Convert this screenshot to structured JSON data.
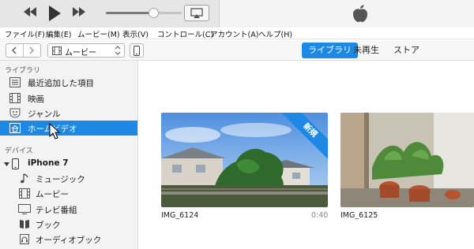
{
  "player": {
    "prev_icon": "rewind-icon",
    "play_icon": "play-icon",
    "next_icon": "fast-forward-icon",
    "volume_level": 0.62,
    "airplay_icon": "airplay-icon",
    "logo_icon": "apple-logo-icon"
  },
  "menubar": {
    "file": "ファイル(F)",
    "edit": "編集(E)",
    "movie": "ムービー(M)",
    "view": "表示(V)",
    "controls": "コントロール(C)",
    "account": "アカウント(A)",
    "help": "ヘルプ(H)"
  },
  "navbar": {
    "media_label": "ムービー",
    "tabs": {
      "library": "ライブラリ",
      "unwatched": "未再生",
      "store": "ストア"
    },
    "active_tab": "library"
  },
  "sidebar": {
    "library_header": "ライブラリ",
    "library_items": [
      {
        "label": "最近追加した項目",
        "icon": "recently-added-icon"
      },
      {
        "label": "映画",
        "icon": "film-icon"
      },
      {
        "label": "ジャンル",
        "icon": "genre-icon"
      },
      {
        "label": "ホームビデオ",
        "icon": "home-video-icon",
        "selected": true
      }
    ],
    "devices_header": "デバイス",
    "device": {
      "label": "iPhone 7",
      "icon": "iphone-icon"
    },
    "device_items": [
      {
        "label": "ミュージック",
        "icon": "music-note-icon"
      },
      {
        "label": "ムービー",
        "icon": "film-icon"
      },
      {
        "label": "テレビ番組",
        "icon": "tv-icon"
      },
      {
        "label": "ブック",
        "icon": "book-icon"
      },
      {
        "label": "オーディオブック",
        "icon": "audiobook-icon"
      }
    ]
  },
  "main": {
    "videos": [
      {
        "title": "IMG_6124",
        "duration": "0:40",
        "badge": "新規"
      },
      {
        "title": "IMG_6125",
        "duration": ""
      }
    ]
  },
  "colors": {
    "accent": "#1e88e5",
    "sidebar_bg": "#f3f3f3",
    "player_bg": "#e6e6e6"
  }
}
